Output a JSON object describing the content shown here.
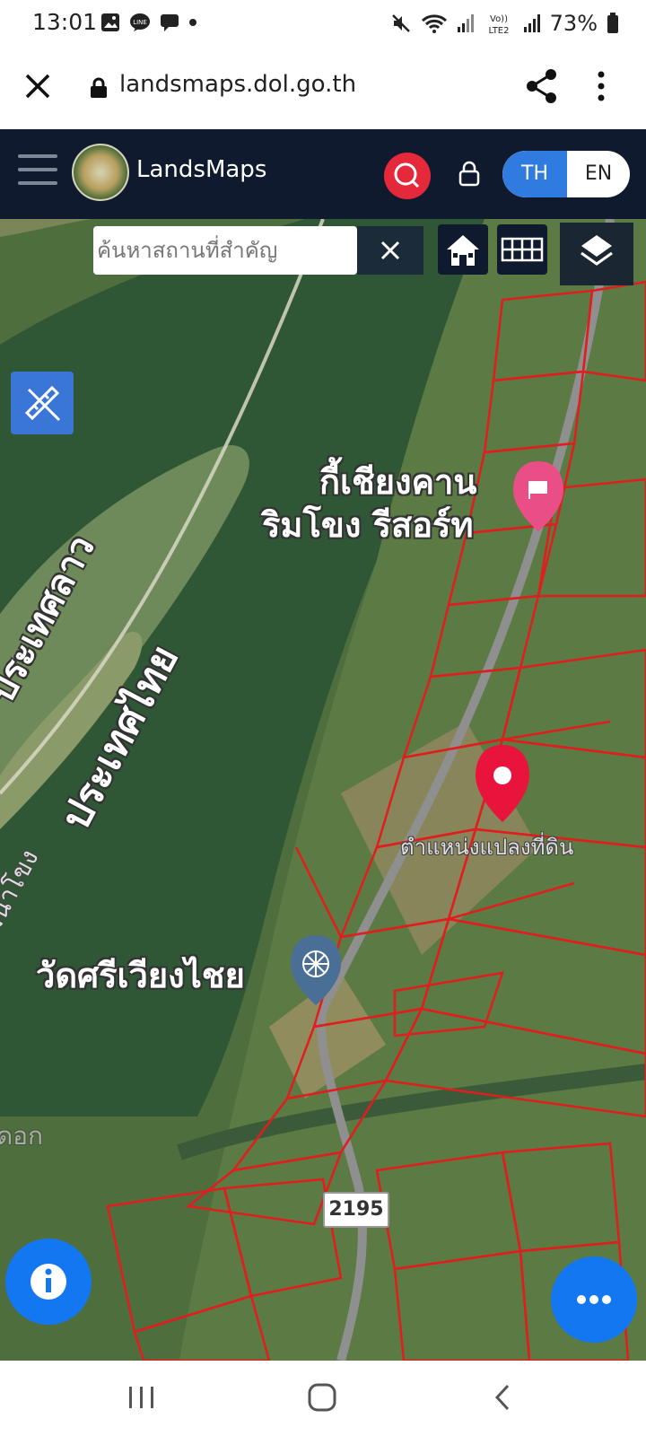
{
  "status_bar": {
    "time": "13:01",
    "notification_icons": [
      "gallery-icon",
      "line-icon",
      "chat-icon",
      "dot-icon"
    ],
    "right_icons": [
      "mute-icon",
      "wifi-icon",
      "signal-icon",
      "volte-lte2-icon",
      "signal-icon"
    ],
    "volte_label": "Vo))",
    "lte_label": "LTE2",
    "battery": "73%"
  },
  "browser": {
    "url": "landsmaps.dol.go.th"
  },
  "app": {
    "name": "LandsMaps",
    "lang_th": "TH",
    "lang_en": "EN",
    "active_lang": "TH",
    "accent_color": "#2f7be0",
    "header_color": "#0f1a2e",
    "search_color": "#e6293a"
  },
  "map": {
    "search_placeholder": "ค้นหาสถานที่สำคัญ",
    "labels": {
      "resort_line1": "กี้เชียงคาน",
      "resort_line2": "ริมโขง รีสอร์ท",
      "laos": "ประเทศลาว",
      "thailand": "ประเทศไทย",
      "river": "แม่น้ำโขง",
      "parcel": "ตำแหน่งแปลงที่ดิน",
      "temple": "วัดศรีเวียงไชย",
      "road_number": "2195",
      "edge_fragment": "ดอก"
    },
    "parcel_color": "#e11d1d",
    "marker_color": "#e8143c"
  }
}
